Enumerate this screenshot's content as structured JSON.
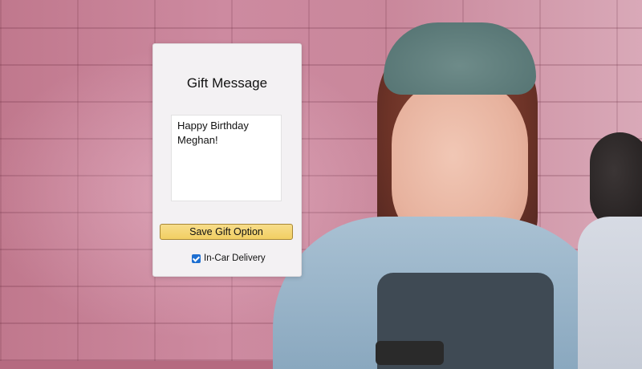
{
  "gift_dialog": {
    "title": "Gift Message",
    "message_value": "Happy Birthday\nMeghan!",
    "save_button_label": "Save Gift Option",
    "in_car_delivery": {
      "label": "In-Car Delivery",
      "checked": true
    }
  },
  "colors": {
    "button_fill": "#f2cf63",
    "checkbox_accent": "#1e6fd1",
    "background_pink": "#c9879b"
  }
}
